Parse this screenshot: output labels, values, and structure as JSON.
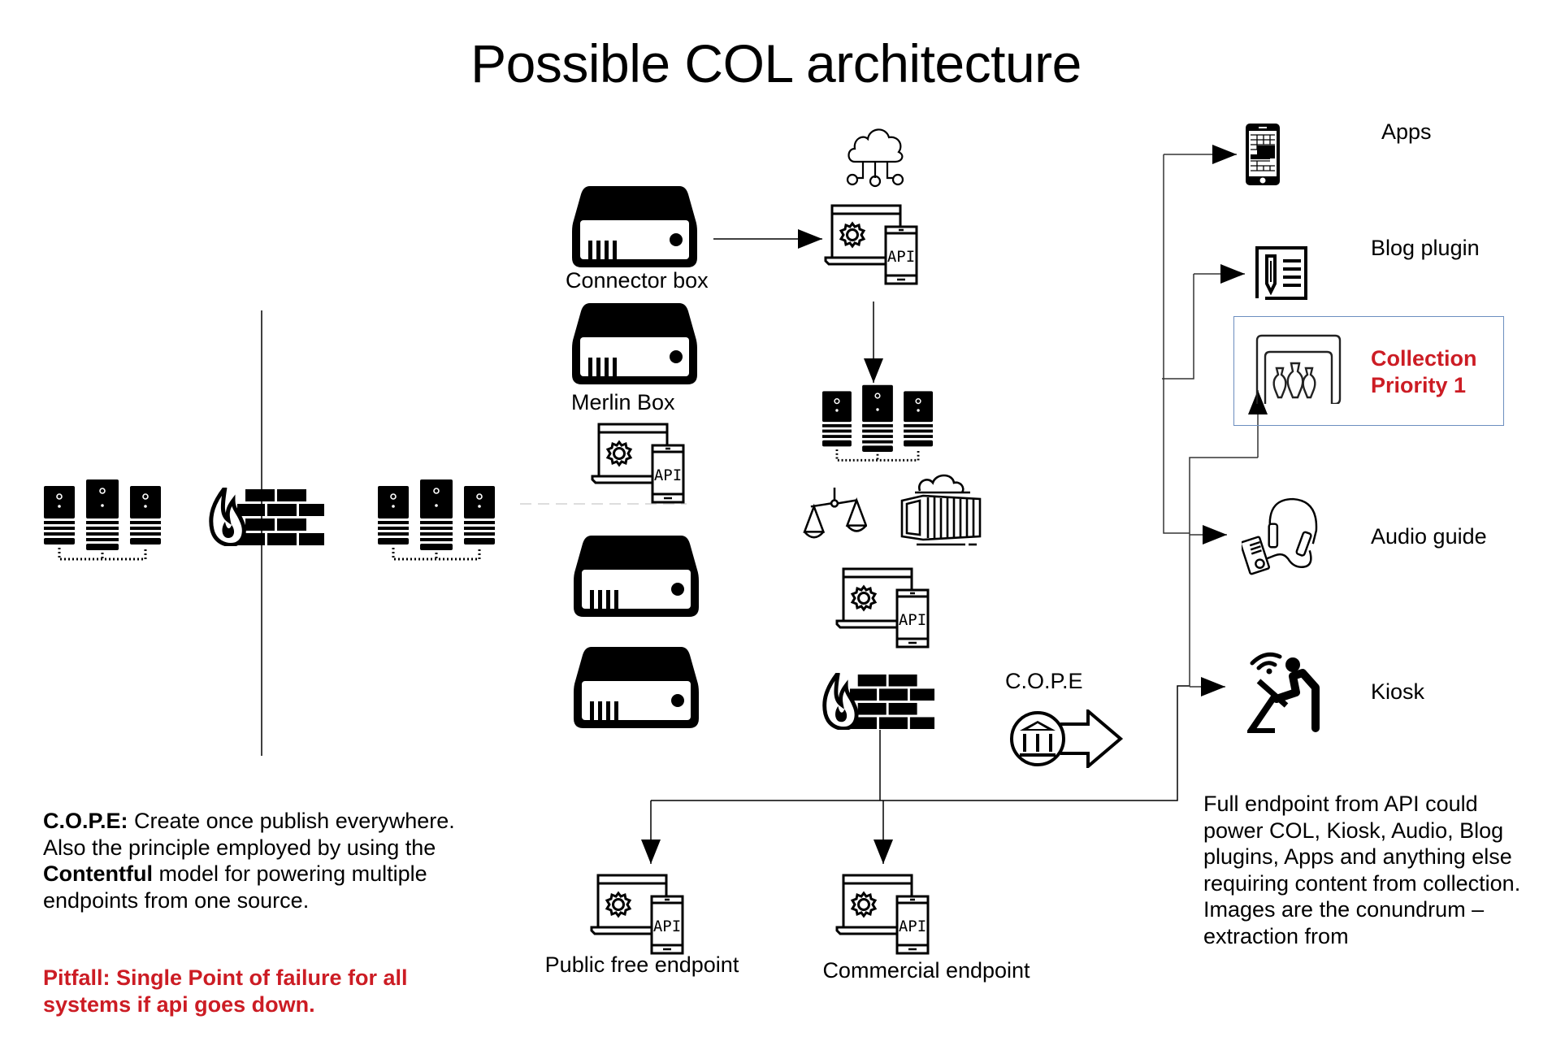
{
  "title": "Possible COL architecture",
  "nodes": {
    "connector_box": {
      "label": "Connector box",
      "icon": "hard-drive-icon"
    },
    "merlin_box": {
      "label": "Merlin Box",
      "icon": "hard-drive-icon"
    },
    "public_endpoint": {
      "label": "Public free endpoint",
      "icon": "api-icon"
    },
    "commercial_endpoint": {
      "label": "Commercial endpoint",
      "icon": "api-icon"
    },
    "cope": {
      "label": "C.O.P.E",
      "icon": "museum-arrow-icon"
    },
    "api_glyph": "API"
  },
  "outputs": [
    {
      "label": "Apps",
      "icon": "smartphone-icon"
    },
    {
      "label": "Blog plugin",
      "icon": "blog-edit-icon"
    },
    {
      "label_line1": "Collection",
      "label_line2": "Priority 1",
      "icon": "collection-vases-icon",
      "highlight": true
    },
    {
      "label": "Audio guide",
      "icon": "audio-guide-icon"
    },
    {
      "label": "Kiosk",
      "icon": "kiosk-icon"
    }
  ],
  "notes": {
    "cope_term": "C.O.P.E:",
    "cope_text_1": " Create once publish everywhere. Also the principle employed by using the ",
    "cope_brand": "Contentful",
    "cope_text_2": " model for powering multiple endpoints from one source.",
    "pitfall": "Pitfall: Single Point of failure for all systems if api goes down.",
    "endpoint_note": "Full endpoint from API could power COL, Kiosk, Audio, Blog plugins, Apps and anything else requiring content from collection. Images are the conundrum – extraction from"
  },
  "colors": {
    "accent_red": "#cc1c24",
    "highlight_border": "#6c8ebf",
    "line": "#000000"
  }
}
